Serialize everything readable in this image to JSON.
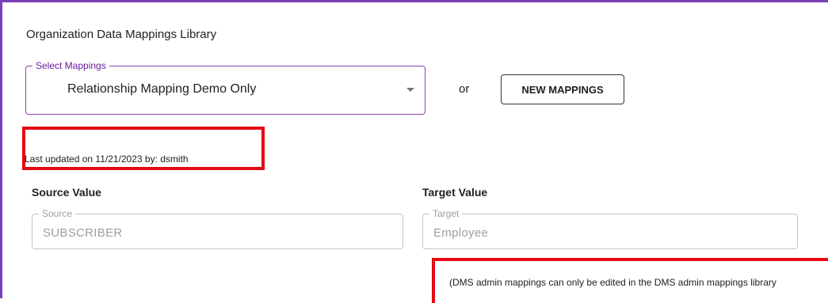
{
  "library": {
    "title": "Organization Data Mappings Library"
  },
  "select_mappings": {
    "label": "Select Mappings",
    "value": "Relationship Mapping Demo Only",
    "icon": "chevron-down-icon"
  },
  "or_text": "or",
  "new_mappings_button": "NEW MAPPINGS",
  "last_updated": "Last updated on 11/21/2023 by: dsmith",
  "source": {
    "header": "Source Value",
    "field_label": "Source",
    "value": "SUBSCRIBER"
  },
  "target": {
    "header": "Target Value",
    "field_label": "Target",
    "value": "Employee"
  },
  "note": "(DMS admin mappings can only be edited in the DMS admin mappings library",
  "colors": {
    "frame_border": "#7a3fb7",
    "select_border": "#8e44ad",
    "highlight": "#e50914"
  }
}
